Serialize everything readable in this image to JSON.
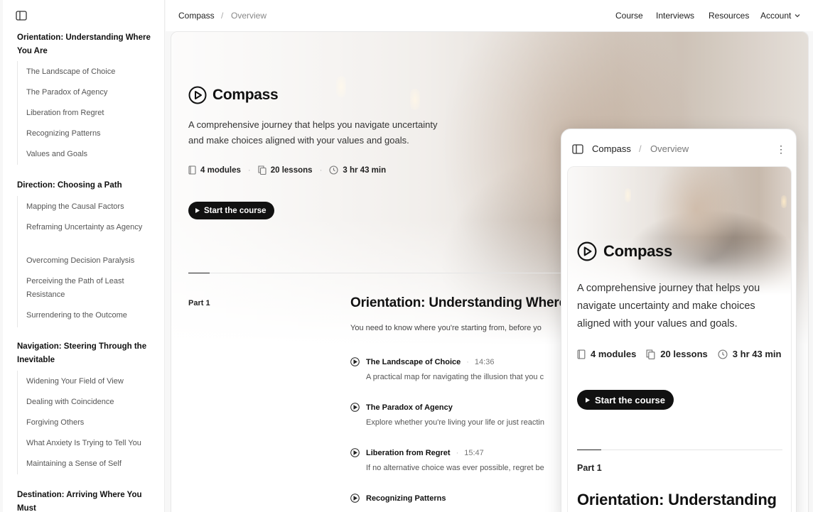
{
  "sidebar": {
    "sections": [
      {
        "title": "Orientation: Understanding Where You Are",
        "items": [
          "The Landscape of Choice",
          "The Paradox of Agency",
          "Liberation from Regret",
          "Recognizing Patterns",
          "Values and Goals"
        ]
      },
      {
        "title": "Direction: Choosing a Path",
        "items": [
          "Mapping the Causal Factors",
          "Reframing Uncertainty as Agency",
          "Overcoming Decision Paralysis",
          "Perceiving the Path of Least Resistance",
          "Surrendering to the Outcome"
        ]
      },
      {
        "title": "Navigation: Steering Through the Inevitable",
        "items": [
          "Widening Your Field of View",
          "Dealing with Coincidence",
          "Forgiving Others",
          "What Anxiety Is Trying to Tell You",
          "Maintaining a Sense of Self"
        ]
      },
      {
        "title": "Destination: Arriving Where You Must",
        "items": []
      }
    ]
  },
  "header": {
    "breadcrumb": [
      "Compass",
      "/",
      "Overview"
    ],
    "nav": [
      "Course",
      "Interviews",
      "Resources",
      "Account"
    ]
  },
  "course": {
    "name": "Compass",
    "tagline_line1": "A comprehensive journey that helps you navigate uncertainty",
    "tagline_line2": "and make choices aligned with your values and goals.",
    "modules": "4 modules",
    "lessons": "20 lessons",
    "duration": "3 hr 43 min",
    "start_label": "Start the course"
  },
  "part": {
    "label": "Part 1",
    "title": "Orientation: Understanding Where Y",
    "desc": "You need to know where you're starting from, before yo",
    "lessons": [
      {
        "title": "The Landscape of Choice",
        "duration": "14:36",
        "desc": "A practical map for navigating the illusion that you c"
      },
      {
        "title": "The Paradox of Agency",
        "duration": "",
        "desc": "Explore whether you're living your life or just reactin"
      },
      {
        "title": "Liberation from Regret",
        "duration": "15:47",
        "desc": "If no alternative choice was ever possible, regret be"
      },
      {
        "title": "Recognizing Patterns",
        "duration": "",
        "desc": ""
      }
    ]
  },
  "mobile": {
    "breadcrumb": [
      "Compass",
      "/",
      "Overview"
    ],
    "more": "⋮",
    "name": "Compass",
    "tagline": "A comprehensive journey that helps you navigate uncertainty and make choices aligned with your values and goals.",
    "modules": "4 modules",
    "lessons": "20 lessons",
    "duration": "3 hr 43 min",
    "start_label": "Start the course",
    "part_label": "Part 1",
    "module_title": "Orientation: Understanding"
  }
}
